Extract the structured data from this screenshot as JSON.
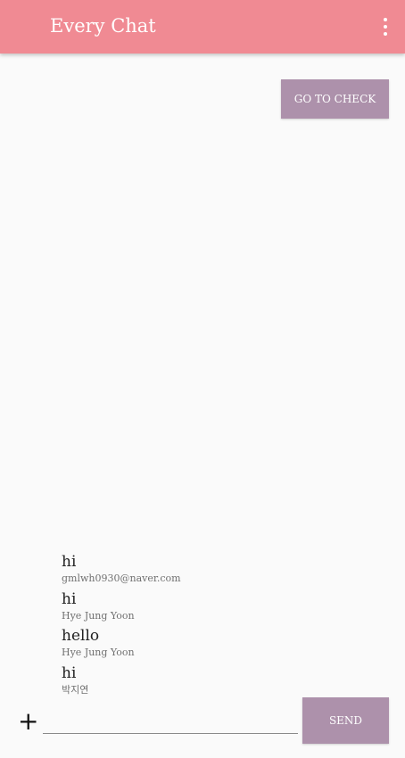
{
  "app_bar": {
    "title": "Every Chat",
    "menu_icon": "more-vert-icon",
    "background_color": "#f08a93"
  },
  "actions": {
    "check_label": "GO TO CHECK",
    "send_label": "SEND",
    "add_icon": "plus-icon",
    "button_color": "#ad91ab"
  },
  "messages": [
    {
      "text": "hi",
      "sender": "gmlwh0930@naver.com"
    },
    {
      "text": "hi",
      "sender": "Hye Jung Yoon"
    },
    {
      "text": "hello",
      "sender": "Hye Jung Yoon"
    },
    {
      "text": "hi",
      "sender": "박지연"
    }
  ],
  "composer": {
    "value": "",
    "placeholder": ""
  }
}
